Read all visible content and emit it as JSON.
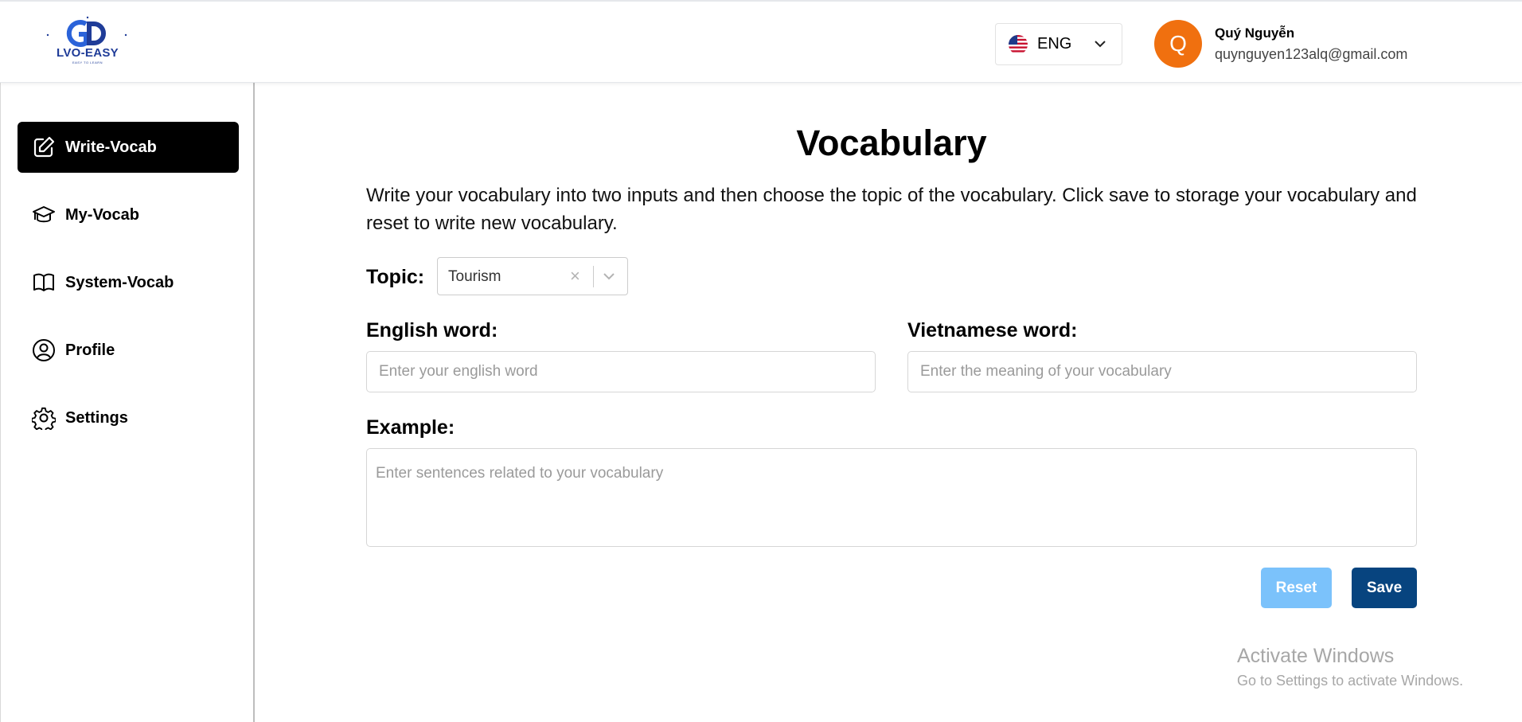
{
  "header": {
    "logo_text": "LVO-EASY",
    "logo_subtext": "EASY TO LEARN",
    "language": {
      "label": "ENG",
      "flag": "us-flag-icon"
    },
    "user": {
      "avatar_initial": "Q",
      "avatar_color": "#f0700f",
      "name": "Quý Nguyễn",
      "email": "quynguyen123alq@gmail.com"
    }
  },
  "sidebar": {
    "items": [
      {
        "label": "Write-Vocab",
        "icon": "pencil-square-icon",
        "active": true
      },
      {
        "label": "My-Vocab",
        "icon": "graduation-cap-icon",
        "active": false
      },
      {
        "label": "System-Vocab",
        "icon": "open-book-icon",
        "active": false
      },
      {
        "label": "Profile",
        "icon": "user-circle-icon",
        "active": false
      },
      {
        "label": "Settings",
        "icon": "gear-icon",
        "active": false
      }
    ]
  },
  "main": {
    "title": "Vocabulary",
    "description": "Write your vocabulary into two inputs and then choose the topic of the vocabulary. Click save to storage your vocabulary and reset to write new vocabulary.",
    "topic": {
      "label": "Topic:",
      "value": "Tourism"
    },
    "english": {
      "label": "English word:",
      "placeholder": "Enter your english word"
    },
    "vietnamese": {
      "label": "Vietnamese word:",
      "placeholder": "Enter the meaning of your vocabulary"
    },
    "example": {
      "label": "Example:",
      "placeholder": "Enter sentences related to your vocabulary"
    },
    "buttons": {
      "reset": "Reset",
      "save": "Save"
    }
  },
  "watermark": {
    "line1": "Activate Windows",
    "line2": "Go to Settings to activate Windows."
  },
  "colors": {
    "accent_active": "#000000",
    "reset_button": "#7bc2fb",
    "save_button": "#07447f",
    "logo": "#1f3c98"
  }
}
